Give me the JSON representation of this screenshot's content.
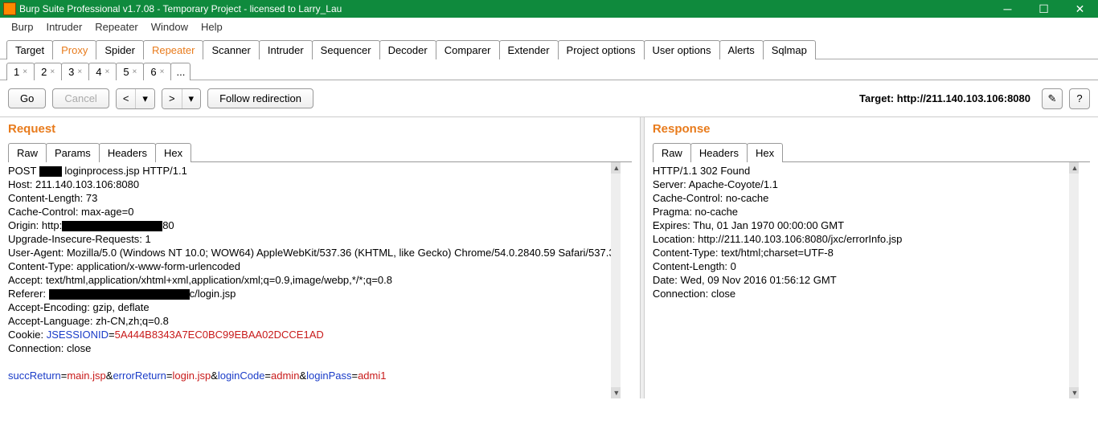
{
  "window": {
    "title": "Burp Suite Professional v1.7.08 - Temporary Project - licensed to Larry_Lau"
  },
  "menu": {
    "items": [
      "Burp",
      "Intruder",
      "Repeater",
      "Window",
      "Help"
    ]
  },
  "maintabs": {
    "items": [
      "Target",
      "Proxy",
      "Spider",
      "Repeater",
      "Scanner",
      "Intruder",
      "Sequencer",
      "Decoder",
      "Comparer",
      "Extender",
      "Project options",
      "User options",
      "Alerts",
      "Sqlmap"
    ],
    "active": "Repeater",
    "highlight": [
      "Proxy",
      "Repeater"
    ]
  },
  "subtabs": {
    "items": [
      "1",
      "2",
      "3",
      "4",
      "5",
      "6"
    ],
    "active": "6",
    "dots": "..."
  },
  "toolbar": {
    "go": "Go",
    "cancel": "Cancel",
    "prev": "<",
    "prev2": "▾",
    "next": ">",
    "next2": "▾",
    "follow": "Follow redirection",
    "target_label": "Target: ",
    "target_value": "http://211.140.103.106:8080",
    "pencil": "✎",
    "help": "?"
  },
  "request": {
    "title": "Request",
    "tabs": [
      "Raw",
      "Params",
      "Headers",
      "Hex"
    ],
    "active": "Raw",
    "method": "POST ",
    "redact1_w": 28,
    "path": " loginprocess.jsp HTTP/1.1",
    "lines": [
      "Host: 211.140.103.106:8080",
      "Content-Length: 73",
      "Cache-Control: max-age=0"
    ],
    "origin_pre": "Origin: http:",
    "origin_redact_w": 125,
    "origin_post": "80",
    "lines2": [
      "Upgrade-Insecure-Requests: 1",
      "User-Agent: Mozilla/5.0 (Windows NT 10.0; WOW64) AppleWebKit/537.36 (KHTML, like Gecko) Chrome/54.0.2840.59 Safari/537.36",
      "Content-Type: application/x-www-form-urlencoded",
      "Accept: text/html,application/xhtml+xml,application/xml;q=0.9,image/webp,*/*;q=0.8"
    ],
    "referer_pre": "Referer: ",
    "referer_redact_w": 175,
    "referer_post": "c/login.jsp",
    "lines3": [
      "Accept-Encoding: gzip, deflate",
      "Accept-Language: zh-CN,zh;q=0.8"
    ],
    "cookie_pre": "Cookie: ",
    "cookie_name": "JSESSIONID",
    "cookie_eq": "=",
    "cookie_val": "5A444B8343A7EC0BC99EBAA02DCCE1AD",
    "conn": "Connection: close",
    "body": {
      "p1n": "succReturn",
      "p1v": "main.jsp",
      "p2n": "errorReturn",
      "p2v": "login.jsp",
      "p3n": "loginCode",
      "p3v": "admin",
      "p4n": "loginPass",
      "p4v": "admi1",
      "eq": "=",
      "amp": "&"
    }
  },
  "response": {
    "title": "Response",
    "tabs": [
      "Raw",
      "Headers",
      "Hex"
    ],
    "active": "Raw",
    "lines": [
      "HTTP/1.1 302 Found",
      "Server: Apache-Coyote/1.1",
      "Cache-Control: no-cache",
      "Pragma: no-cache",
      "Expires: Thu, 01 Jan 1970 00:00:00 GMT",
      "Location: http://211.140.103.106:8080/jxc/errorInfo.jsp",
      "Content-Type: text/html;charset=UTF-8",
      "Content-Length: 0",
      "Date: Wed, 09 Nov 2016 01:56:12 GMT",
      "Connection: close"
    ]
  }
}
